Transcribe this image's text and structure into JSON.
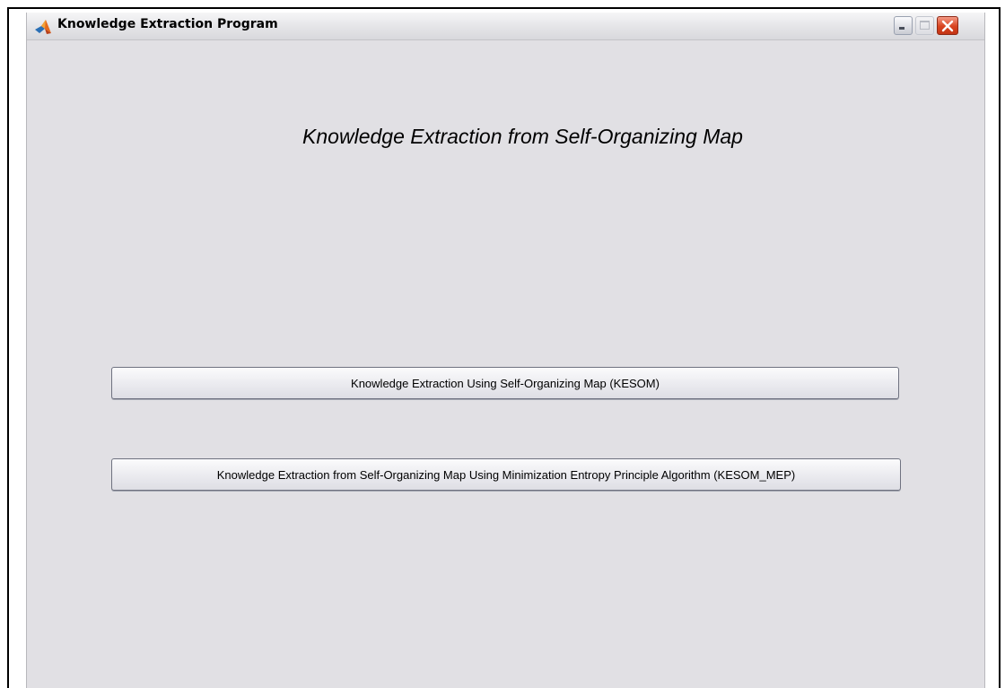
{
  "window": {
    "title": "Knowledge Extraction Program",
    "icon": "matlab-icon",
    "controls": [
      "minimize-icon",
      "maximize-icon",
      "close-icon"
    ]
  },
  "main": {
    "heading": "Knowledge Extraction from Self-Organizing Map",
    "buttons": [
      {
        "label": "Knowledge Extraction Using Self-Organizing Map (KESOM)"
      },
      {
        "label": "Knowledge Extraction from Self-Organizing Map Using Minimization Entropy Principle Algorithm (KESOM_MEP)"
      }
    ]
  },
  "colors": {
    "window_bg": "#e1e0e4",
    "close_button": "#d8431f"
  }
}
